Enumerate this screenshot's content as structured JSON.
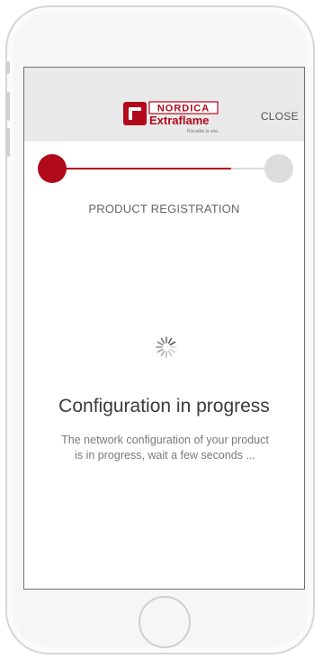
{
  "header": {
    "brand_top": "NORDICA",
    "brand_main": "Extraflame",
    "brand_tagline": "Riscalda la vita.",
    "close_label": "CLOSE",
    "brand_color": "#b10a1a"
  },
  "stepper": {
    "current_step": 1,
    "total_steps": 2,
    "progress_fraction": 0.8,
    "active_color": "#b10a1a",
    "inactive_color": "#dcdcdc",
    "title": "PRODUCT REGISTRATION"
  },
  "status": {
    "spinner_icon": "loading-spinner-icon",
    "title": "Configuration in progress",
    "message_line1": "The network configuration of your product",
    "message_line2": "is in progress, wait a few seconds ..."
  }
}
